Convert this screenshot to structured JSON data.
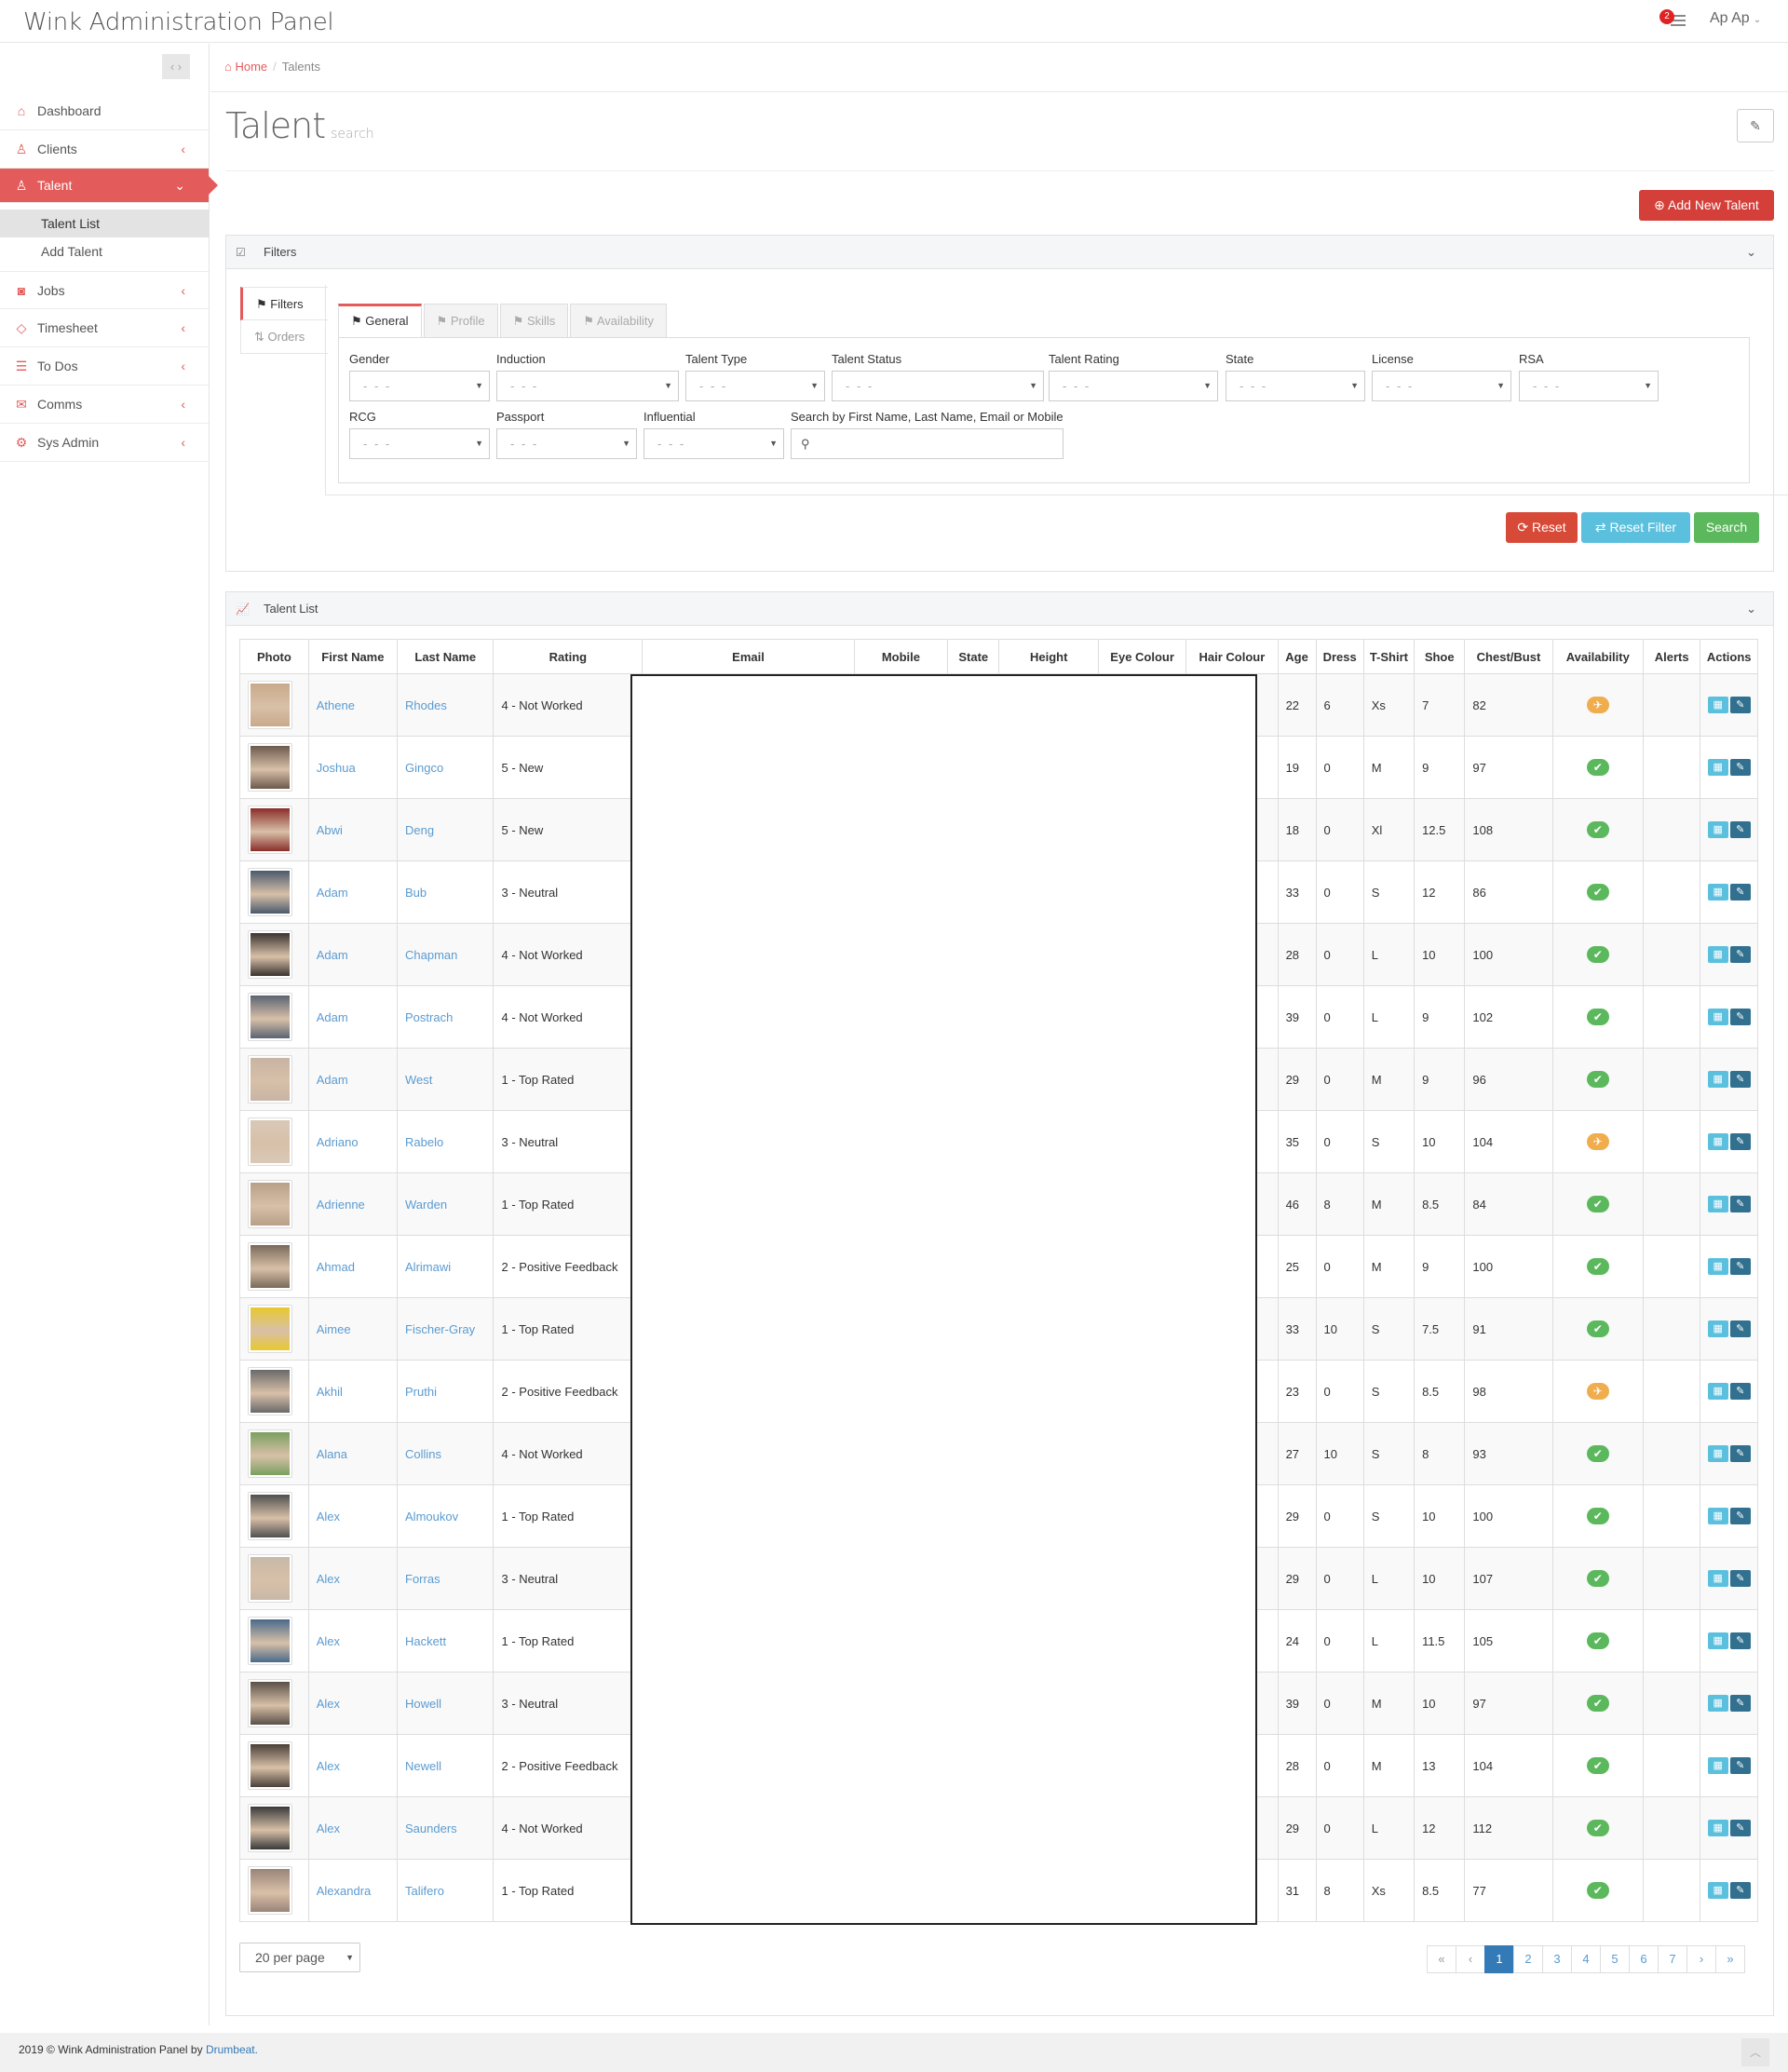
{
  "app": {
    "title": "Wink Administration Panel"
  },
  "topbar": {
    "notification_count": "2",
    "user": "Ap Ap"
  },
  "sidebar": {
    "items": [
      {
        "label": "Dashboard",
        "icon": "home-icon"
      },
      {
        "label": "Clients",
        "icon": "user-icon"
      },
      {
        "label": "Talent",
        "icon": "users-icon",
        "active": true,
        "children": [
          "Talent List",
          "Add Talent"
        ]
      },
      {
        "label": "Jobs",
        "icon": "camera-icon"
      },
      {
        "label": "Timesheet",
        "icon": "diamond-icon"
      },
      {
        "label": "To Dos",
        "icon": "list-icon"
      },
      {
        "label": "Comms",
        "icon": "envelope-icon"
      },
      {
        "label": "Sys Admin",
        "icon": "gear-icon"
      }
    ]
  },
  "breadcrumb": {
    "home": "Home",
    "current": "Talents"
  },
  "page": {
    "title": "Talent",
    "subtitle": "search",
    "add_button": "Add New Talent"
  },
  "filters": {
    "title": "Filters",
    "side_tabs": [
      "Filters",
      "Orders"
    ],
    "tabs": [
      "General",
      "Profile",
      "Skills",
      "Availability"
    ],
    "placeholder": "- - -",
    "labels": {
      "gender": "Gender",
      "induction": "Induction",
      "talent_type": "Talent Type",
      "talent_status": "Talent Status",
      "talent_rating": "Talent Rating",
      "state": "State",
      "license": "License",
      "rsa": "RSA",
      "rcg": "RCG",
      "passport": "Passport",
      "influential": "Influential",
      "search": "Search by First Name, Last Name, Email or Mobile"
    },
    "buttons": {
      "reset": "Reset",
      "reset_filter": "Reset Filter",
      "search": "Search"
    }
  },
  "list": {
    "title": "Talent List",
    "columns": [
      "Photo",
      "First Name",
      "Last Name",
      "Rating",
      "Email",
      "Mobile",
      "State",
      "Height",
      "Eye Colour",
      "Hair Colour",
      "Age",
      "Dress",
      "T-Shirt",
      "Shoe",
      "Chest/Bust",
      "Availability",
      "Alerts",
      "Actions"
    ],
    "rows": [
      {
        "first": "Athene",
        "last": "Rhodes",
        "rating": "4 - Not Worked",
        "age": "22",
        "dress": "6",
        "tshirt": "Xs",
        "shoe": "7",
        "chest": "82",
        "avail": "no",
        "photo": "#c9a98a"
      },
      {
        "first": "Joshua",
        "last": "Gingco",
        "rating": "5 - New",
        "age": "19",
        "dress": "0",
        "tshirt": "M",
        "shoe": "9",
        "chest": "97",
        "avail": "ok",
        "photo": "#6d5a4e"
      },
      {
        "first": "Abwi",
        "last": "Deng",
        "rating": "5 - New",
        "age": "18",
        "dress": "0",
        "tshirt": "Xl",
        "shoe": "12.5",
        "chest": "108",
        "avail": "ok",
        "photo": "#8a2e2a"
      },
      {
        "first": "Adam",
        "last": "Bub",
        "rating": "3 - Neutral",
        "age": "33",
        "dress": "0",
        "tshirt": "S",
        "shoe": "12",
        "chest": "86",
        "avail": "ok",
        "photo": "#4a5a6e"
      },
      {
        "first": "Adam",
        "last": "Chapman",
        "rating": "4 - Not Worked",
        "age": "28",
        "dress": "0",
        "tshirt": "L",
        "shoe": "10",
        "chest": "100",
        "avail": "ok",
        "photo": "#3a3430"
      },
      {
        "first": "Adam",
        "last": "Postrach",
        "rating": "4 - Not Worked",
        "age": "39",
        "dress": "0",
        "tshirt": "L",
        "shoe": "9",
        "chest": "102",
        "avail": "ok",
        "photo": "#5a6472"
      },
      {
        "first": "Adam",
        "last": "West",
        "rating": "1 - Top Rated",
        "age": "29",
        "dress": "0",
        "tshirt": "M",
        "shoe": "9",
        "chest": "96",
        "avail": "ok",
        "photo": "#c8b4a4"
      },
      {
        "first": "Adriano",
        "last": "Rabelo",
        "rating": "3 - Neutral",
        "age": "35",
        "dress": "0",
        "tshirt": "S",
        "shoe": "10",
        "chest": "104",
        "avail": "no",
        "photo": "#d9c8b8"
      },
      {
        "first": "Adrienne",
        "last": "Warden",
        "rating": "1 - Top Rated",
        "age": "46",
        "dress": "8",
        "tshirt": "M",
        "shoe": "8.5",
        "chest": "84",
        "avail": "ok",
        "photo": "#b8a088"
      },
      {
        "first": "Ahmad",
        "last": "Alrimawi",
        "rating": "2 - Positive Feedback",
        "age": "25",
        "dress": "0",
        "tshirt": "M",
        "shoe": "9",
        "chest": "100",
        "avail": "ok",
        "photo": "#7a6a5a"
      },
      {
        "first": "Aimee",
        "last": "Fischer-Gray",
        "rating": "1 - Top Rated",
        "age": "33",
        "dress": "10",
        "tshirt": "S",
        "shoe": "7.5",
        "chest": "91",
        "avail": "ok",
        "photo": "#e8c830"
      },
      {
        "first": "Akhil",
        "last": "Pruthi",
        "rating": "2 - Positive Feedback",
        "age": "23",
        "dress": "0",
        "tshirt": "S",
        "shoe": "8.5",
        "chest": "98",
        "avail": "no",
        "photo": "#6a6a6a"
      },
      {
        "first": "Alana",
        "last": "Collins",
        "rating": "4 - Not Worked",
        "age": "27",
        "dress": "10",
        "tshirt": "S",
        "shoe": "8",
        "chest": "93",
        "avail": "ok",
        "photo": "#7aa060"
      },
      {
        "first": "Alex",
        "last": "Almoukov",
        "rating": "1 - Top Rated",
        "age": "29",
        "dress": "0",
        "tshirt": "S",
        "shoe": "10",
        "chest": "100",
        "avail": "ok",
        "photo": "#505050"
      },
      {
        "first": "Alex",
        "last": "Forras",
        "rating": "3 - Neutral",
        "age": "29",
        "dress": "0",
        "tshirt": "L",
        "shoe": "10",
        "chest": "107",
        "avail": "ok",
        "photo": "#c8b8a8"
      },
      {
        "first": "Alex",
        "last": "Hackett",
        "rating": "1 - Top Rated",
        "age": "24",
        "dress": "0",
        "tshirt": "L",
        "shoe": "11.5",
        "chest": "105",
        "avail": "ok",
        "photo": "#4a6a8a"
      },
      {
        "first": "Alex",
        "last": "Howell",
        "rating": "3 - Neutral",
        "age": "39",
        "dress": "0",
        "tshirt": "M",
        "shoe": "10",
        "chest": "97",
        "avail": "ok",
        "photo": "#5a5048"
      },
      {
        "first": "Alex",
        "last": "Newell",
        "rating": "2 - Positive Feedback",
        "age": "28",
        "dress": "0",
        "tshirt": "M",
        "shoe": "13",
        "chest": "104",
        "avail": "ok",
        "photo": "#4a4038"
      },
      {
        "first": "Alex",
        "last": "Saunders",
        "rating": "4 - Not Worked",
        "age": "29",
        "dress": "0",
        "tshirt": "L",
        "shoe": "12",
        "chest": "112",
        "avail": "ok",
        "photo": "#3a3a3a"
      },
      {
        "first": "Alexandra",
        "last": "Talifero",
        "rating": "1 - Top Rated",
        "age": "31",
        "dress": "8",
        "tshirt": "Xs",
        "shoe": "8.5",
        "chest": "77",
        "avail": "ok",
        "photo": "#9a8478"
      }
    ]
  },
  "pagination": {
    "per_page": "20 per page",
    "pages": [
      "«",
      "‹",
      "1",
      "2",
      "3",
      "4",
      "5",
      "6",
      "7",
      "›",
      "»"
    ],
    "current": "1"
  },
  "footer": {
    "text": "2019 © Wink Administration Panel by",
    "link": "Drumbeat."
  },
  "colors": {
    "accent": "#e35b5a",
    "link": "#5b9bd1",
    "danger": "#d43f3a",
    "info": "#5bc0de",
    "success": "#5cb85c",
    "warning": "#f0ad4e"
  }
}
